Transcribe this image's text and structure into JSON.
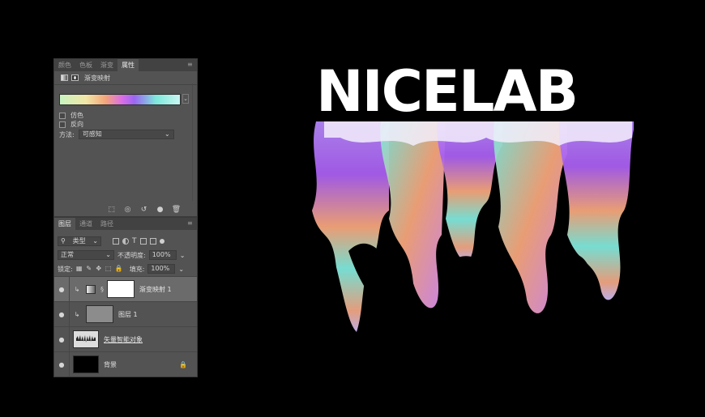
{
  "properties_panel": {
    "tabs": [
      "颜色",
      "色板",
      "渐变",
      "属性"
    ],
    "active_tab": "属性",
    "adjustment_title": "渐变映射",
    "checkboxes": [
      {
        "label": "仿色",
        "checked": false
      },
      {
        "label": "反向",
        "checked": false
      }
    ],
    "method_label": "方法:",
    "method_value": "可感知"
  },
  "layers_panel": {
    "tabs": [
      "图层",
      "通道",
      "路径"
    ],
    "active_tab": "图层",
    "filter_kind": "类型",
    "blend_mode": "正常",
    "opacity_label": "不透明度:",
    "opacity_value": "100%",
    "lock_label": "锁定:",
    "fill_label": "填充:",
    "fill_value": "100%",
    "layers": [
      {
        "name": "渐变映射 1",
        "selected": true,
        "clipped": true
      },
      {
        "name": "图层 1",
        "selected": false,
        "clipped": true
      },
      {
        "name": "矢量智能对象",
        "selected": false,
        "clipped": false
      },
      {
        "name": "背景",
        "selected": false,
        "clipped": false
      }
    ]
  },
  "artwork": {
    "text": "NICELAB",
    "colors": [
      "#c49bf6",
      "#a85ef0",
      "#f5a57a",
      "#7de8dc",
      "#ffffff"
    ]
  }
}
